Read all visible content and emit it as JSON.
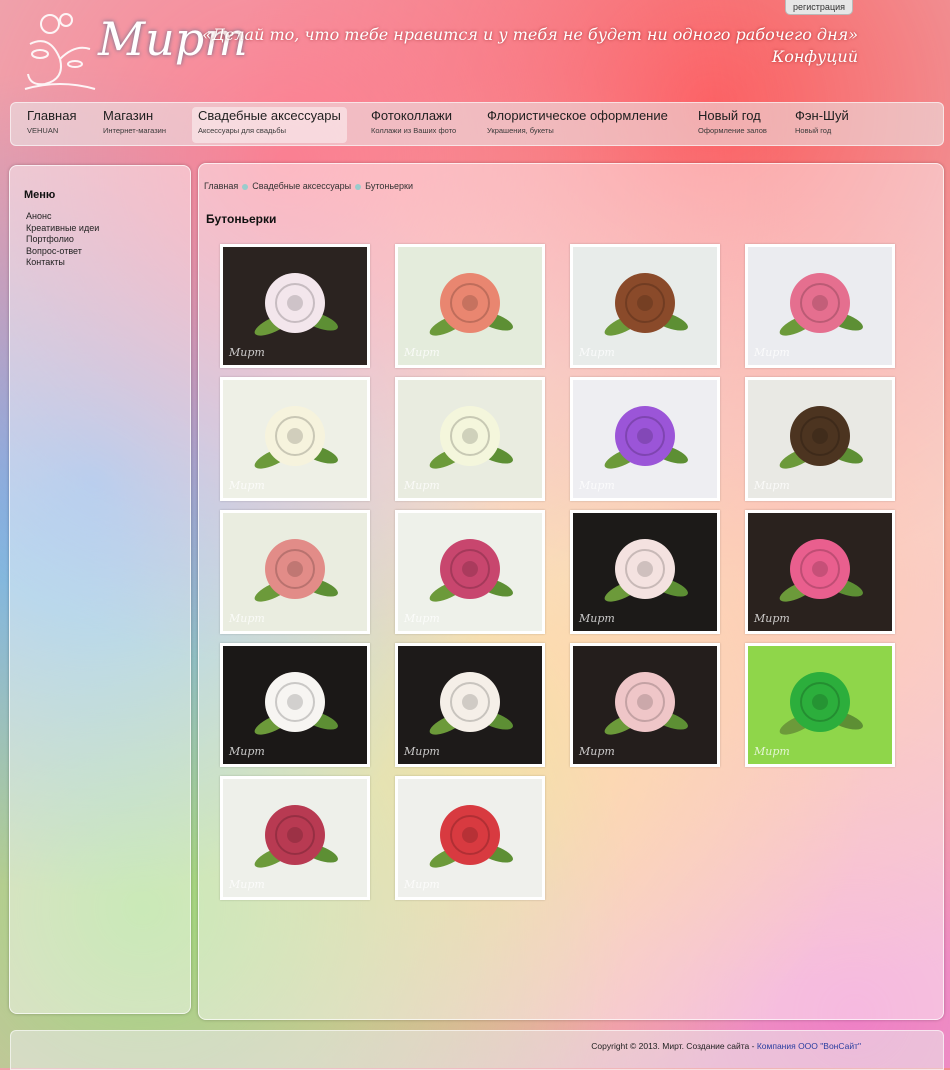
{
  "header": {
    "logo_text": "Мирт",
    "quote_line": "«Делай то, что тебе нравится и у тебя не будет ни одного рабочего дня»",
    "quote_author": "Конфуций",
    "register_label": "регистрация"
  },
  "nav": {
    "items": [
      {
        "title": "Главная",
        "sub": "VEHUAN"
      },
      {
        "title": "Магазин",
        "sub": "Интернет-магазин"
      },
      {
        "title": "Свадебные аксессуары",
        "sub": "Аксессуары для свадьбы"
      },
      {
        "title": "Фотоколлажи",
        "sub": "Коллажи из Ваших фото"
      },
      {
        "title": "Флористическое оформление",
        "sub": "Украшения, букеты"
      },
      {
        "title": "Новый год",
        "sub": "Оформление залов"
      },
      {
        "title": "Фэн-Шуй",
        "sub": "Новый год"
      }
    ]
  },
  "sidebar": {
    "title": "Меню",
    "items": [
      "Анонс",
      "Креативные идеи",
      "Портфолио",
      "Вопрос-ответ",
      "Контакты"
    ]
  },
  "breadcrumb": [
    "Главная",
    "Свадебные аксессуары",
    "Бутоньерки"
  ],
  "page_title": "Бутоньерки",
  "gallery": {
    "watermark": "Мирт",
    "items": [
      {
        "flower": "#f3e6ec",
        "bg": "#2b2320"
      },
      {
        "flower": "#e98670",
        "bg": "#e4ecdc"
      },
      {
        "flower": "#8a4a2a",
        "bg": "#e8ecea"
      },
      {
        "flower": "#e56f8f",
        "bg": "#ebecf0"
      },
      {
        "flower": "#f6f3dd",
        "bg": "#eef0e6"
      },
      {
        "flower": "#f4f6dc",
        "bg": "#e9ece0"
      },
      {
        "flower": "#9b55d8",
        "bg": "#eeeef2"
      },
      {
        "flower": "#4c3420",
        "bg": "#e9e9e4"
      },
      {
        "flower": "#e28c88",
        "bg": "#eaede0"
      },
      {
        "flower": "#c8466e",
        "bg": "#eef1ea"
      },
      {
        "flower": "#f4e2e0",
        "bg": "#1c1a18"
      },
      {
        "flower": "#e95f8e",
        "bg": "#2a221e"
      },
      {
        "flower": "#f7f5f2",
        "bg": "#1b1817"
      },
      {
        "flower": "#f5efe8",
        "bg": "#1d1a19"
      },
      {
        "flower": "#efc6c8",
        "bg": "#241e1c"
      },
      {
        "flower": "#2cae3c",
        "bg": "#8fd64a"
      },
      {
        "flower": "#b83a52",
        "bg": "#eef0ea"
      },
      {
        "flower": "#d83a40",
        "bg": "#eff0ec"
      }
    ]
  },
  "footer": {
    "text": "Copyright © 2013. Мирт. Создание сайта - ",
    "link": "Компания ООО \"ВонСайт\""
  }
}
